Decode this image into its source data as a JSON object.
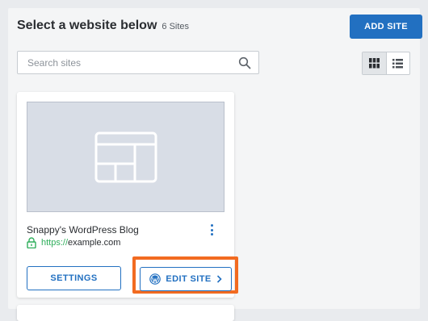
{
  "header": {
    "title": "Select a website below",
    "site_count": "6 Sites",
    "add_site_label": "ADD SITE"
  },
  "search": {
    "placeholder": "Search sites",
    "value": ""
  },
  "view_toggle": {
    "active": "grid",
    "options": [
      "grid-view-icon",
      "list-view-icon"
    ]
  },
  "site_card": {
    "name": "Snappy's WordPress Blog",
    "url_protocol": "https://",
    "url_host": "example.com",
    "settings_label": "SETTINGS",
    "edit_label": "EDIT SITE"
  },
  "colors": {
    "accent": "#2270c1",
    "secure": "#2fae5b",
    "highlight": "#f26b21"
  }
}
